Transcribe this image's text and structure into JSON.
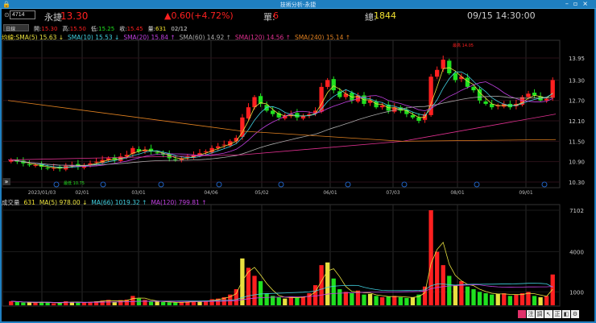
{
  "window": {
    "title": "技術分析-永捷"
  },
  "quote": {
    "code": "4714",
    "name": "永捷",
    "price": "13.30",
    "change": "▲0.60(+4.72%)",
    "single_label": "單:",
    "single": "6",
    "total_label": "總:",
    "total": "1844",
    "time": "09/15 14:30:00"
  },
  "ohlc": {
    "period": "日線",
    "open_label": "開:",
    "open": "15.30",
    "high_label": "高:",
    "high": "15.50",
    "low_label": "低:",
    "low": "15.25",
    "close_label": "收:",
    "close": "15.45",
    "vol_label": "量:",
    "vol": "631",
    "date": "02/12"
  },
  "ma_legend": {
    "label": "均線:",
    "items": [
      "SMA(5) 15.63 ↓",
      "SMA(10) 15.53 ↓",
      "SMA(20) 15.84 ↑",
      "SMA(60) 14.92 ↑",
      "SMA(120) 14.56 ↑",
      "SMA(240) 15.14 ↑"
    ]
  },
  "vol_legend": {
    "label": "成交量",
    "value": "631",
    "items": [
      "MA(5) 978.00 ↓",
      "MA(66) 1019.32 ↑",
      "MA(120) 799.81 ↑"
    ]
  },
  "colors": {
    "up": "#ff2020",
    "down": "#20e020",
    "sma5": "#e8e040",
    "sma10": "#40d0e0",
    "sma20": "#c040e0",
    "sma60": "#aaaaaa",
    "sma120": "#e03090",
    "sma240": "#e08020"
  },
  "toolbar": {
    "icons": [
      "draw-icon",
      "note-icon",
      "adjust-icon",
      "cursor-icon",
      "fix-icon",
      "layout-icon",
      "gear-icon"
    ],
    "labels": [
      "",
      "注",
      "調",
      "↖",
      "正",
      "◧",
      "⚙"
    ]
  },
  "chart_data": {
    "type": "candlestick",
    "price_axis": {
      "ticks": [
        "13.95",
        "13.30",
        "12.70",
        "12.10",
        "11.50",
        "10.90",
        "10.30"
      ],
      "range": [
        10.3,
        13.95
      ]
    },
    "volume_axis": {
      "ticks": [
        "7102",
        "4000",
        "1000"
      ],
      "range": [
        0,
        7102
      ]
    },
    "x_ticks": [
      "2023/01/03",
      "02/01",
      "03/01",
      "04/06",
      "05/02",
      "06/01",
      "07/03",
      "08/01",
      "09/01"
    ],
    "annotations": {
      "low": "最低 10.75",
      "high": "最高 14.05"
    },
    "closes": [
      10.95,
      10.9,
      10.85,
      10.8,
      10.8,
      10.75,
      10.7,
      10.72,
      10.7,
      10.78,
      10.8,
      10.75,
      10.8,
      10.85,
      10.9,
      10.95,
      11.0,
      10.95,
      11.05,
      11.1,
      11.3,
      11.2,
      11.25,
      11.2,
      11.15,
      11.1,
      11.0,
      10.95,
      11.0,
      11.05,
      11.1,
      11.15,
      11.2,
      11.3,
      11.35,
      11.4,
      11.5,
      11.6,
      12.2,
      12.5,
      12.8,
      12.6,
      12.4,
      12.3,
      12.2,
      12.25,
      12.3,
      12.2,
      12.25,
      12.3,
      12.4,
      13.1,
      13.3,
      13.0,
      12.8,
      12.9,
      12.7,
      12.85,
      12.6,
      12.7,
      12.5,
      12.55,
      12.4,
      12.5,
      12.4,
      12.3,
      12.2,
      12.1,
      12.3,
      13.4,
      13.6,
      13.9,
      13.5,
      13.3,
      13.4,
      13.1,
      13.0,
      12.7,
      12.6,
      12.5,
      12.55,
      12.6,
      12.5,
      12.6,
      12.8,
      12.9,
      12.85,
      12.7,
      12.75,
      13.3
    ],
    "volumes": [
      300,
      250,
      200,
      220,
      180,
      260,
      200,
      150,
      180,
      300,
      240,
      200,
      220,
      260,
      300,
      350,
      400,
      250,
      380,
      420,
      700,
      500,
      400,
      300,
      280,
      250,
      220,
      200,
      240,
      260,
      300,
      280,
      320,
      450,
      500,
      600,
      800,
      1200,
      3500,
      2800,
      2200,
      1800,
      900,
      700,
      600,
      500,
      650,
      550,
      600,
      900,
      1500,
      3000,
      3200,
      2000,
      1200,
      1000,
      900,
      1100,
      800,
      850,
      700,
      600,
      650,
      700,
      600,
      550,
      600,
      800,
      1400,
      7102,
      4000,
      3000,
      2200,
      1500,
      1800,
      1400,
      1200,
      1000,
      900,
      800,
      850,
      900,
      700,
      800,
      900,
      1000,
      700,
      600,
      700,
      2300
    ]
  }
}
